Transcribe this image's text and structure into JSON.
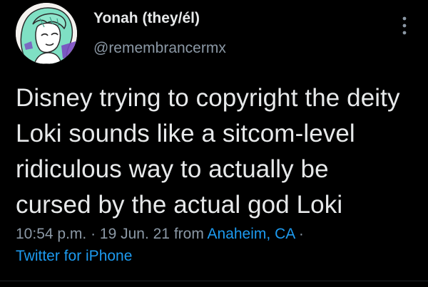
{
  "user": {
    "display_name": "Yonah (they/él)",
    "handle": "@remembrancermx",
    "avatar_icon": "illustrated-avatar"
  },
  "tweet": {
    "text_lines": [
      "Disney trying to copyright the deity",
      "Loki sounds like a sitcom-level",
      "ridiculous way to actually be",
      "cursed by the actual god Loki"
    ]
  },
  "meta": {
    "time": "10:54 p.m.",
    "sep1": " · ",
    "date": "19 Jun. 21",
    "from_label": " from ",
    "location": "Anaheim, CA",
    "sep2": " ·",
    "client": "Twitter for iPhone"
  },
  "icons": {
    "more": "more-vertical-icon"
  },
  "colors": {
    "background": "#000000",
    "text": "#e7e9ea",
    "secondary": "#8b98a5",
    "link": "#1d9bf0",
    "avatar_hair": "#7fe0c4"
  }
}
